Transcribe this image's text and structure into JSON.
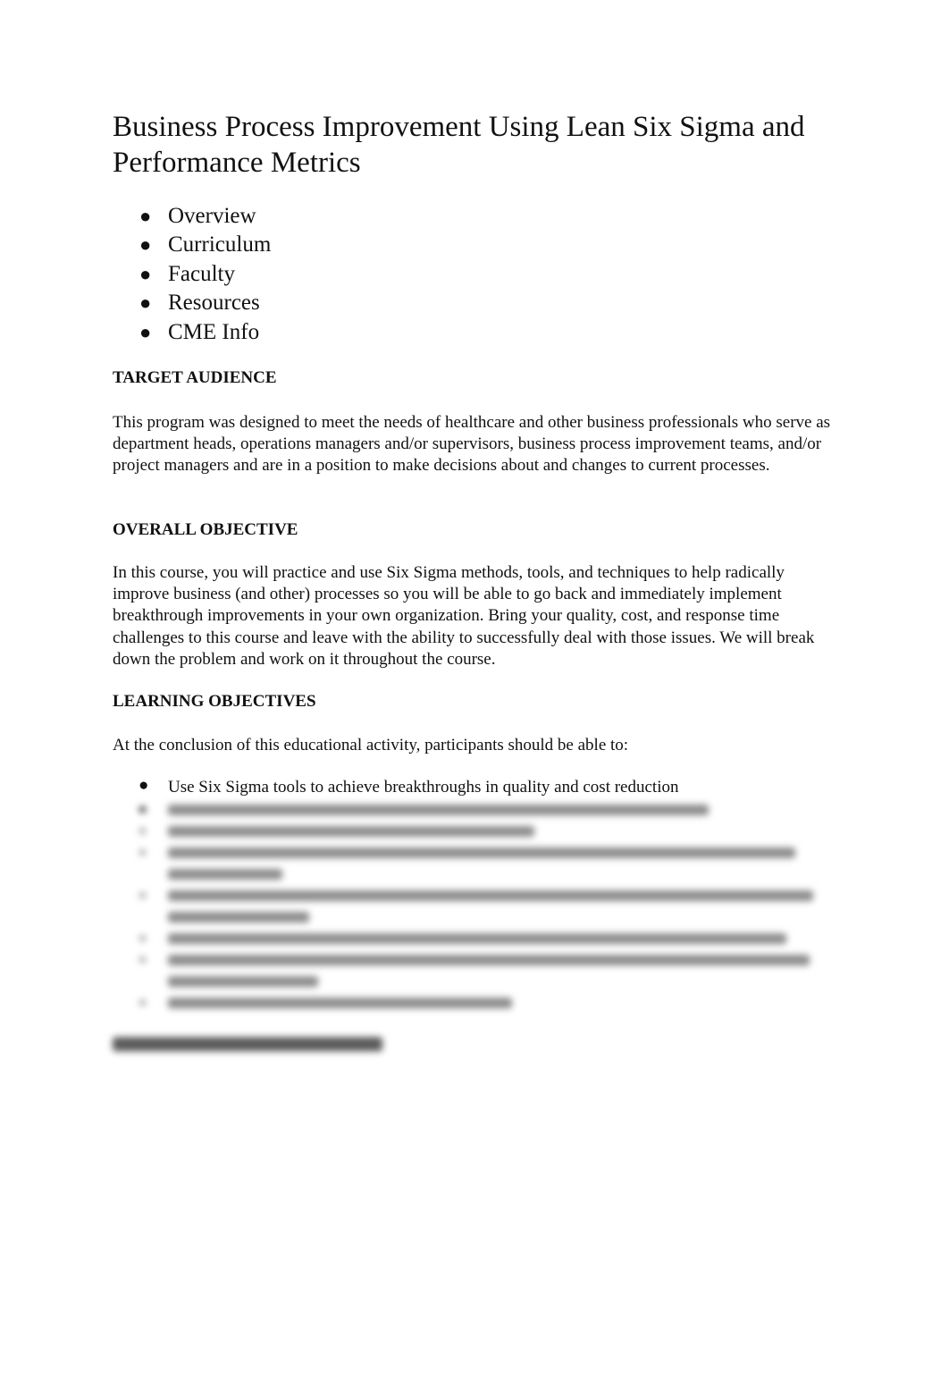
{
  "document": {
    "title": "Business Process Improvement Using Lean Six Sigma and Performance Metrics",
    "nav_links": [
      "Overview",
      "Curriculum",
      "Faculty",
      "Resources",
      "CME Info"
    ],
    "sections": {
      "target_audience": {
        "heading": "TARGET AUDIENCE",
        "body": "This program was designed to meet the needs of healthcare and other business professionals who serve as department heads, operations managers and/or supervisors, business process improvement teams, and/or project managers and are in a position to make decisions about and changes to current processes."
      },
      "overall_objective": {
        "heading": "OVERALL OBJECTIVE",
        "body": "In this course, you will practice and use Six Sigma methods, tools, and techniques to help radically improve business (and other) processes so you will be able to go back and immediately implement breakthrough improvements in your own organization. Bring your quality, cost, and response time challenges to this course and leave with the ability to successfully deal with those issues. We will break down the problem and work on it throughout the course."
      },
      "learning_objectives": {
        "heading": "LEARNING OBJECTIVES",
        "intro": "At the conclusion of this educational activity, participants should be able to:",
        "items": [
          "Use Six Sigma tools to achieve breakthroughs in quality and cost reduction"
        ],
        "blurred_item_count": 7
      }
    },
    "blurred_section_heading_visible": true
  }
}
